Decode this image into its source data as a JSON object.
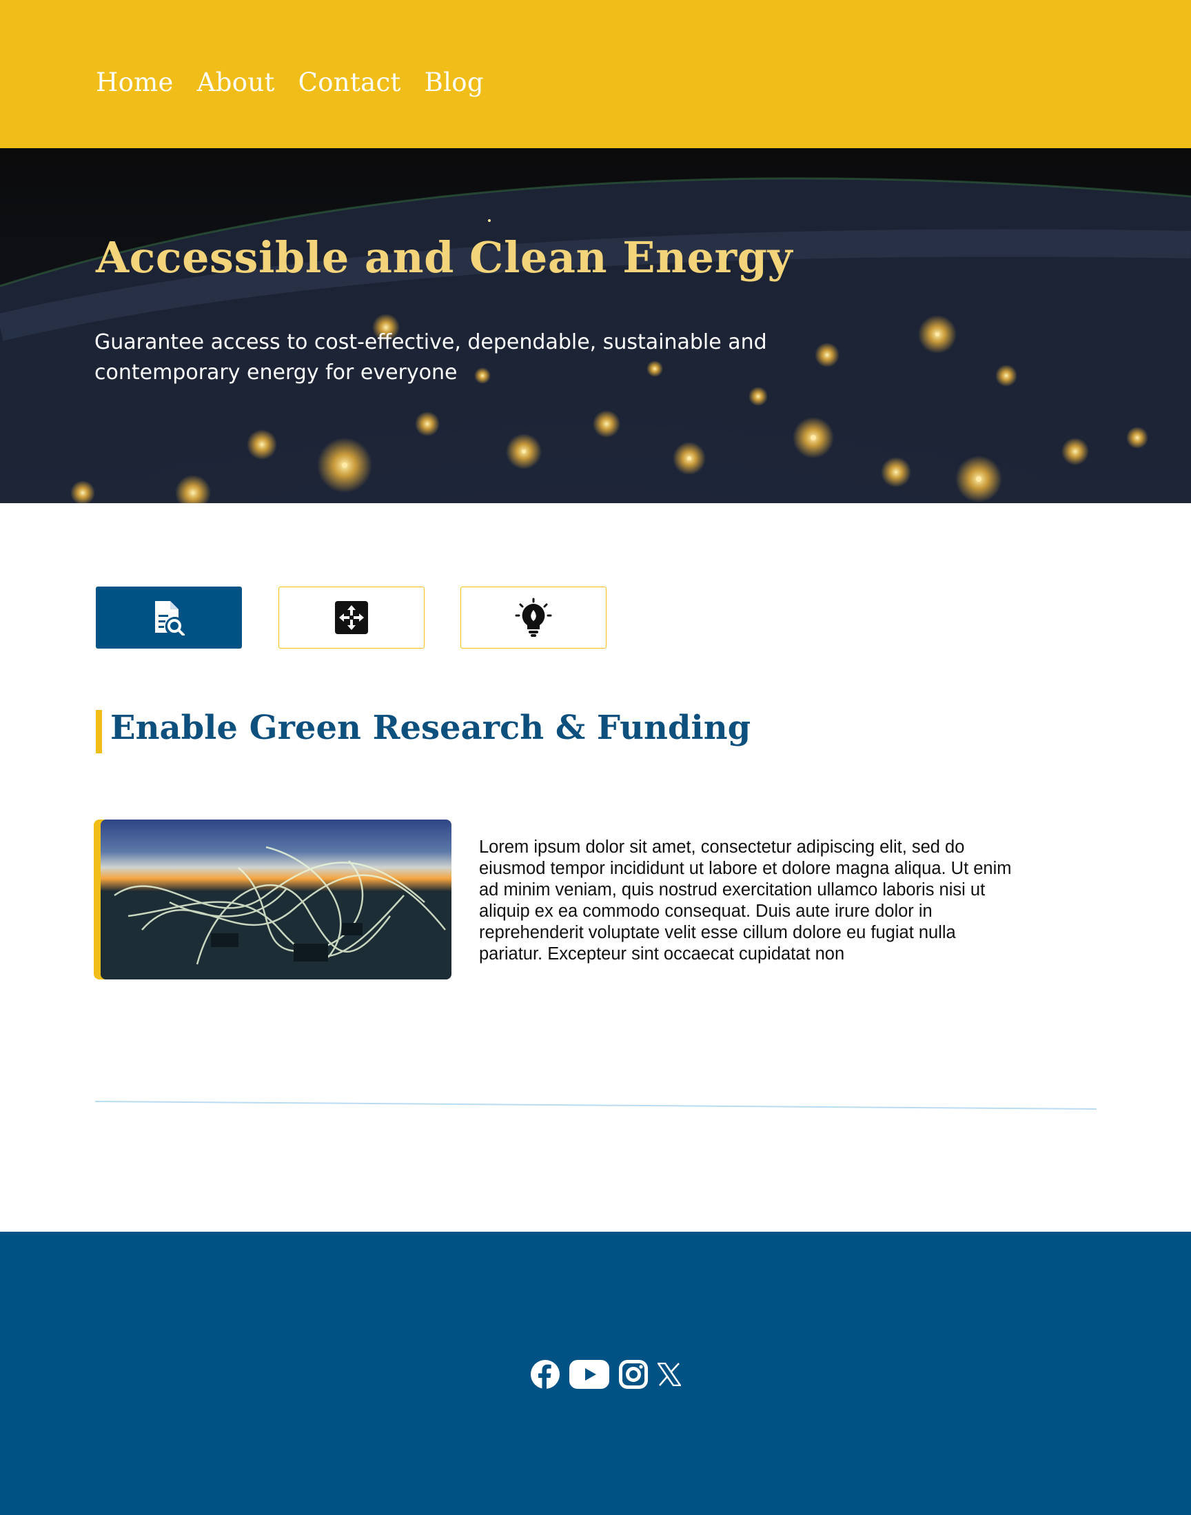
{
  "nav": {
    "items": [
      "Home",
      "About",
      "Contact",
      "Blog"
    ]
  },
  "hero": {
    "title": "Accessible and Clean Energy",
    "subtitle": "Guarantee access to cost-effective, dependable, sustainable and contemporary energy for everyone"
  },
  "tabs": [
    {
      "icon": "document-search-icon",
      "active": true
    },
    {
      "icon": "move-arrows-icon",
      "active": false
    },
    {
      "icon": "lightbulb-icon",
      "active": false
    }
  ],
  "section": {
    "title": "Enable Green Research & Funding",
    "body": "Lorem ipsum dolor sit amet, consectetur adipiscing elit, sed do eiusmod tempor incididunt ut labore et dolore magna aliqua. Ut enim ad minim veniam, quis nostrud exercitation ullamco laboris nisi ut aliquip ex ea commodo consequat. Duis aute irure dolor in reprehenderit  voluptate velit esse cillum dolore eu fugiat nulla pariatur. Excepteur sint occaecat cupidatat non"
  },
  "footer": {
    "socials": [
      "facebook-icon",
      "youtube-icon",
      "instagram-icon",
      "x-icon"
    ]
  },
  "colors": {
    "accent": "#f1bd18",
    "primary": "#005284",
    "heading": "#0d4f7d",
    "hero_title": "#f3d47a"
  }
}
